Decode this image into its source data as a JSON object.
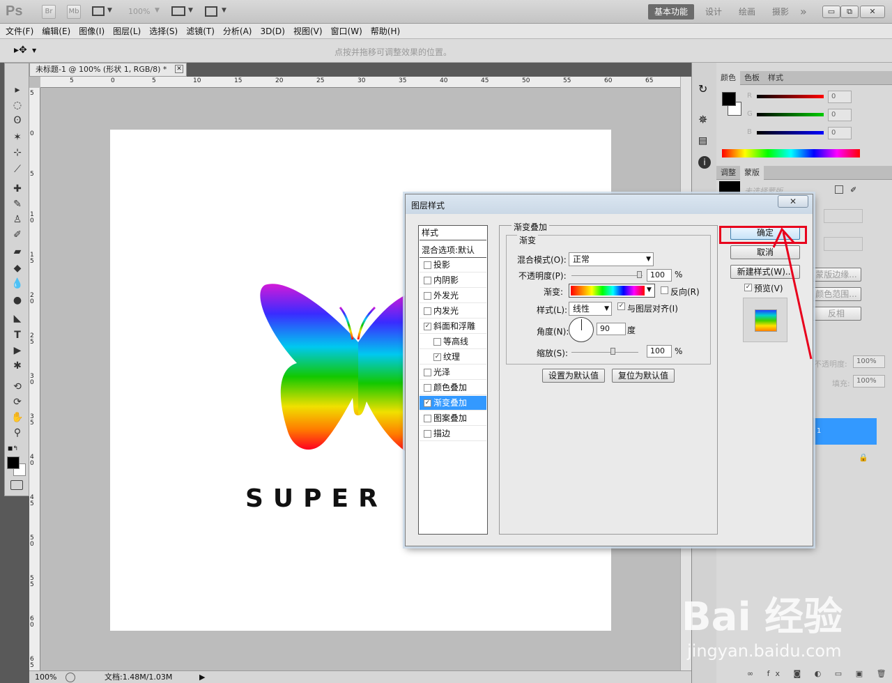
{
  "app": {
    "logo": "Ps",
    "mini": [
      "Br",
      "Mb"
    ],
    "zoom": "100%",
    "workspaces": [
      "基本功能",
      "设计",
      "绘画",
      "摄影"
    ],
    "more": "»"
  },
  "window_controls": {
    "minimize": "▭",
    "restore": "⧉",
    "close": "✕"
  },
  "menu": [
    "文件(F)",
    "编辑(E)",
    "图像(I)",
    "图层(L)",
    "选择(S)",
    "滤镜(T)",
    "分析(A)",
    "3D(D)",
    "视图(V)",
    "窗口(W)",
    "帮助(H)"
  ],
  "options": {
    "hint": "点按并拖移可调整效果的位置。"
  },
  "document": {
    "tab_title": "未标题-1 @ 100% (形状 1, RGB/8) *",
    "tab_close": "✕",
    "canvas_text": "SUPER M",
    "ruler_top": [
      "5",
      "0",
      "5",
      "10",
      "15",
      "20",
      "25",
      "30",
      "35",
      "40",
      "45",
      "50",
      "55",
      "60",
      "65"
    ],
    "ruler_left": [
      "5",
      "0",
      "5",
      "1 0",
      "1 5",
      "2 0",
      "2 5",
      "3 0",
      "3 5",
      "4 0",
      "4 5",
      "5 0",
      "5 5",
      "6 0",
      "6 5"
    ]
  },
  "status": {
    "zoom": "100%",
    "doc": "文档:1.48M/1.03M"
  },
  "panels": {
    "color_tabs": [
      "颜色",
      "色板",
      "样式"
    ],
    "channels": [
      "R",
      "G",
      "B"
    ],
    "channel_values": [
      "0",
      "0",
      "0"
    ],
    "adjust_tabs": [
      "调整",
      "蒙版"
    ],
    "mask_label": "未选择蒙版",
    "mask_buttons": [
      "蒙版边缘...",
      "颜色范围...",
      "反相"
    ],
    "layers_opacity_label": "不透明度:",
    "layers_opacity": "100%",
    "layers_fill_label": "填充:",
    "layers_fill": "100%",
    "layer_selected": "1"
  },
  "dialog": {
    "title": "图层样式",
    "close": "✕",
    "styles_header": "样式",
    "blend_options": "混合选项:默认",
    "items": [
      {
        "label": "投影",
        "checked": false,
        "indent": false,
        "selected": false
      },
      {
        "label": "内阴影",
        "checked": false,
        "indent": false,
        "selected": false
      },
      {
        "label": "外发光",
        "checked": false,
        "indent": false,
        "selected": false
      },
      {
        "label": "内发光",
        "checked": false,
        "indent": false,
        "selected": false
      },
      {
        "label": "斜面和浮雕",
        "checked": true,
        "indent": false,
        "selected": false
      },
      {
        "label": "等高线",
        "checked": false,
        "indent": true,
        "selected": false
      },
      {
        "label": "纹理",
        "checked": true,
        "indent": true,
        "selected": false
      },
      {
        "label": "光泽",
        "checked": false,
        "indent": false,
        "selected": false
      },
      {
        "label": "颜色叠加",
        "checked": false,
        "indent": false,
        "selected": false
      },
      {
        "label": "渐变叠加",
        "checked": true,
        "indent": false,
        "selected": true
      },
      {
        "label": "图案叠加",
        "checked": false,
        "indent": false,
        "selected": false
      },
      {
        "label": "描边",
        "checked": false,
        "indent": false,
        "selected": false
      }
    ],
    "section_title": "渐变叠加",
    "group_title": "渐变",
    "blend_mode_label": "混合模式(O):",
    "blend_mode": "正常",
    "opacity_label": "不透明度(P):",
    "opacity": "100",
    "percent": "%",
    "gradient_label": "渐变:",
    "reverse_label": "反向(R)",
    "reverse_checked": false,
    "style_label": "样式(L):",
    "style": "线性",
    "align_label": "与图层对齐(I)",
    "align_checked": true,
    "angle_label": "角度(N):",
    "angle": "90",
    "angle_unit": "度",
    "scale_label": "缩放(S):",
    "scale": "100",
    "set_default": "设置为默认值",
    "reset_default": "复位为默认值",
    "ok": "确定",
    "cancel": "取消",
    "new_style": "新建样式(W)...",
    "preview_label": "预览(V)",
    "preview_checked": true
  },
  "watermark": {
    "brand": "Bai 经验",
    "url": "jingyan.baidu.com"
  },
  "colors": {
    "accent": "#3399ff",
    "highlight": "#e8001c",
    "dialog_bg": "#eaeaea"
  }
}
